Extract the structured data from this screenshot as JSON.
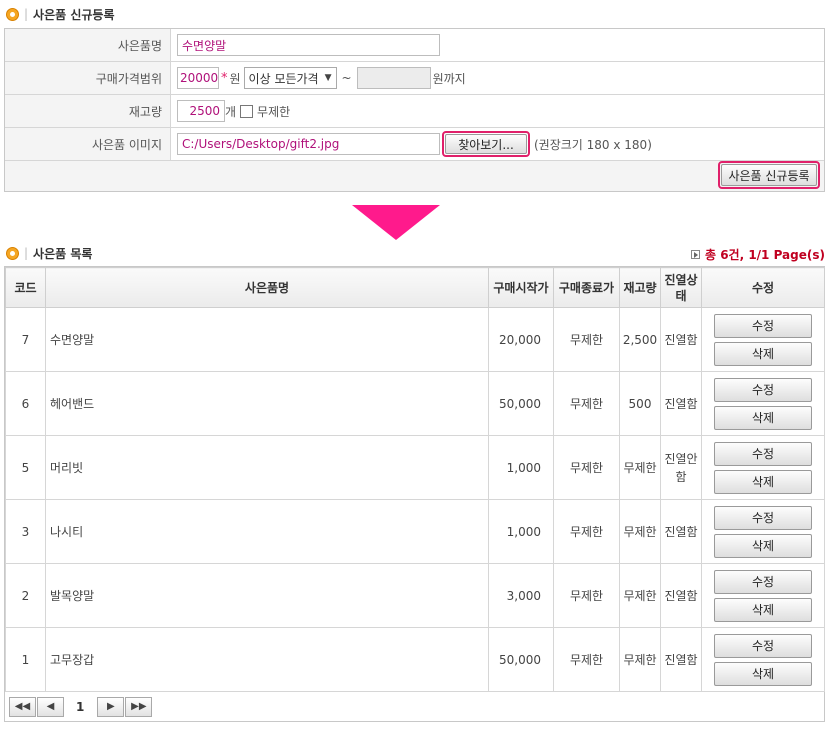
{
  "register": {
    "title": "사은품 신규등록",
    "fields": {
      "name_label": "사은품명",
      "name_value": "수면양말",
      "price_label": "구매가격범위",
      "price_min": "20000",
      "required_mark": "*",
      "won": "원",
      "range_select": "이상 모든가격",
      "tilde": "~",
      "price_max": "",
      "won_until": "원까지",
      "stock_label": "재고량",
      "stock_value": "2500",
      "stock_unit": "개",
      "unlimited_label": "무제한",
      "image_label": "사은품 이미지",
      "image_path": "C:/Users/Desktop/gift2.jpg",
      "browse_button": "찾아보기...",
      "size_hint": "(권장크기 180 x 180)"
    },
    "submit_button": "사은품 신규등록"
  },
  "list": {
    "title": "사은품 목록",
    "total": "총 6건, 1/1 Page(s)",
    "columns": {
      "code": "코드",
      "name": "사은품명",
      "start_price": "구매시작가",
      "end_price": "구매종료가",
      "stock": "재고량",
      "display": "진열상태",
      "edit": "수정"
    },
    "edit_button": "수정",
    "delete_button": "삭제",
    "rows": [
      {
        "code": "7",
        "name": "수면양말",
        "start": "20,000",
        "end": "무제한",
        "stock": "2,500",
        "display": "진열함"
      },
      {
        "code": "6",
        "name": "헤어밴드",
        "start": "50,000",
        "end": "무제한",
        "stock": "500",
        "display": "진열함"
      },
      {
        "code": "5",
        "name": "머리빗",
        "start": "1,000",
        "end": "무제한",
        "stock": "무제한",
        "display": "진열안함"
      },
      {
        "code": "3",
        "name": "나시티",
        "start": "1,000",
        "end": "무제한",
        "stock": "무제한",
        "display": "진열함"
      },
      {
        "code": "2",
        "name": "발목양말",
        "start": "3,000",
        "end": "무제한",
        "stock": "무제한",
        "display": "진열함"
      },
      {
        "code": "1",
        "name": "고무장갑",
        "start": "50,000",
        "end": "무제한",
        "stock": "무제한",
        "display": "진열함"
      }
    ]
  },
  "pager": {
    "current": "1",
    "first_icon": "double-left-arrow",
    "prev_icon": "left-arrow",
    "next_icon": "right-arrow",
    "last_icon": "double-right-arrow"
  },
  "colors": {
    "accent": "#ff1a8c",
    "highlight_border": "#e0206a",
    "input_text": "#b0117a",
    "total_text": "#c00020"
  }
}
